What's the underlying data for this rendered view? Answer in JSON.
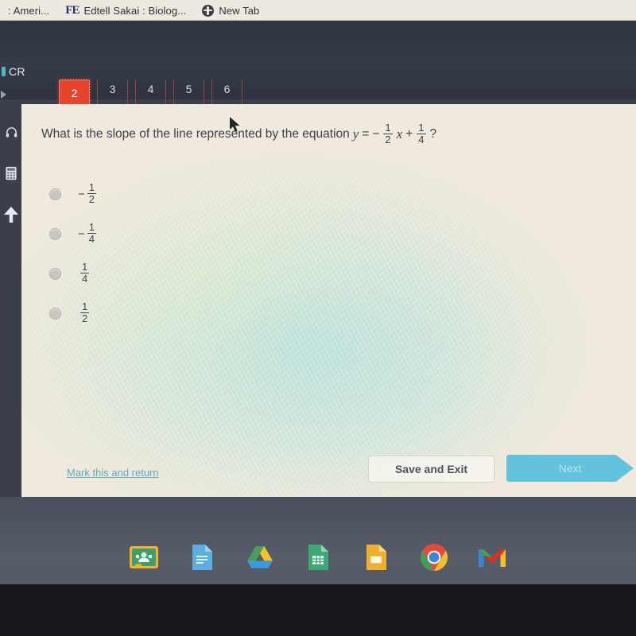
{
  "browser": {
    "tabs": [
      {
        "id": "tab-american",
        "title": ": Ameri...",
        "favicon": "none"
      },
      {
        "id": "tab-edtell-sakai",
        "title": "Edtell Sakai : Biolog...",
        "favicon": "fe-text-icon"
      },
      {
        "id": "tab-new",
        "title": "New Tab",
        "favicon": "globe-icon"
      }
    ]
  },
  "app_header": {
    "label": "CR",
    "accent_color": "#4fb7c4"
  },
  "question_nav": {
    "active": "2",
    "tabs": [
      "2",
      "3",
      "4",
      "5",
      "6"
    ],
    "active_color": "#e8432c",
    "border_color": "#8e4a42"
  },
  "rail": {
    "items": [
      {
        "name": "headphones-icon",
        "label": "Audio"
      },
      {
        "name": "calculator-icon",
        "label": "Calculator"
      },
      {
        "name": "arrow-up-icon",
        "label": "Scroll up"
      }
    ]
  },
  "question": {
    "prefix": "What is the slope of the line represented by the equation",
    "var_y": "y",
    "equals": "=",
    "minus": "−",
    "coef_num": "1",
    "coef_den": "2",
    "var_x": "x",
    "plus": "+",
    "const_num": "1",
    "const_den": "4",
    "suffix": "?",
    "options": [
      {
        "id": "option-a",
        "sign": "−",
        "num": "1",
        "den": "2",
        "selected": false
      },
      {
        "id": "option-b",
        "sign": "−",
        "num": "1",
        "den": "4",
        "selected": false
      },
      {
        "id": "option-c",
        "sign": "",
        "num": "1",
        "den": "4",
        "selected": false
      },
      {
        "id": "option-d",
        "sign": "",
        "num": "1",
        "den": "2",
        "selected": false
      }
    ]
  },
  "footer": {
    "mark_link": "Mark this and return",
    "save_label": "Save and Exit",
    "next_label": "Next",
    "link_color": "#66a6bd",
    "next_color": "#63c3dd"
  },
  "taskbar": {
    "icons": [
      {
        "name": "google-classroom-icon",
        "label": "Classroom"
      },
      {
        "name": "google-docs-icon",
        "label": "Docs"
      },
      {
        "name": "google-drive-icon",
        "label": "Drive"
      },
      {
        "name": "google-sheets-icon",
        "label": "Sheets"
      },
      {
        "name": "google-slides-icon",
        "label": "Slides"
      },
      {
        "name": "google-chrome-icon",
        "label": "Chrome"
      },
      {
        "name": "gmail-icon",
        "label": "Gmail"
      }
    ]
  }
}
